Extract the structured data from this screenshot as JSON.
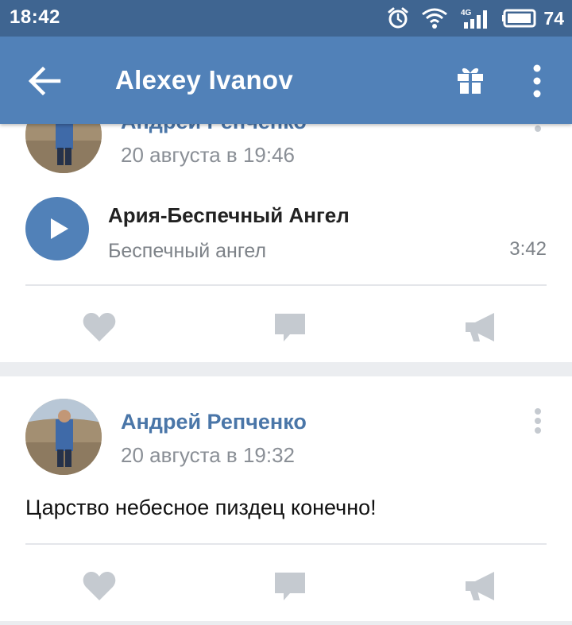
{
  "status_bar": {
    "time": "18:42",
    "network": "4G",
    "battery_level": "74"
  },
  "header": {
    "title": "Alexey Ivanov"
  },
  "posts": [
    {
      "author": "Андрей Репченко",
      "date": "20 августа в 19:46",
      "audio": {
        "title": "Ария-Беспечный Ангел",
        "artist": "Беспечный ангел",
        "duration": "3:42"
      }
    },
    {
      "author": "Андрей Репченко",
      "date": "20 августа в 19:32",
      "text": "Царство небесное пиздец конечно!"
    }
  ],
  "icons": {
    "back": "arrow-back-icon",
    "gift": "gift-icon",
    "more": "more-vert-icon",
    "like": "heart-icon",
    "comment": "comment-icon",
    "share": "megaphone-icon",
    "play": "play-icon"
  },
  "colors": {
    "status_bar": "#3f6591",
    "app_bar": "#5181b8",
    "link": "#4a76a8",
    "action_icon": "#c5cad0"
  }
}
